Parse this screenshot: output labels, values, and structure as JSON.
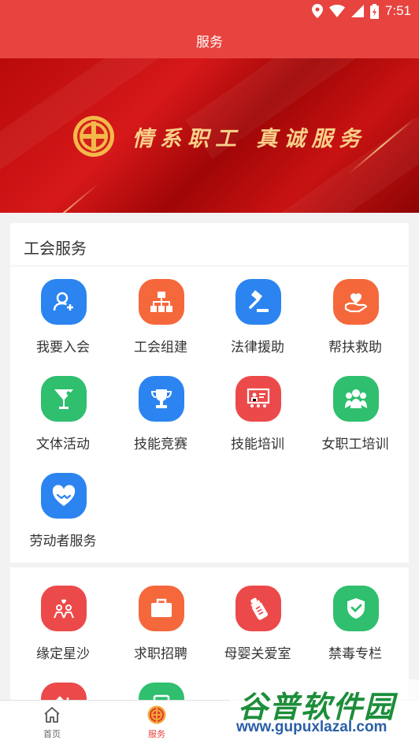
{
  "status_bar": {
    "time": "7:51",
    "icons": [
      "location-icon",
      "wifi-icon",
      "cell-signal-icon",
      "battery-charging-icon"
    ]
  },
  "app_bar": {
    "title": "服务"
  },
  "banner": {
    "slogan": "情系职工 真诚服务",
    "logo": "trade-union-emblem"
  },
  "union_services": {
    "title": "工会服务",
    "items": [
      {
        "label": "我要入会",
        "icon": "add-member-icon",
        "color": "#2b84f0"
      },
      {
        "label": "工会组建",
        "icon": "org-chart-icon",
        "color": "#f5683c"
      },
      {
        "label": "法律援助",
        "icon": "gavel-icon",
        "color": "#2b84f0"
      },
      {
        "label": "帮扶救助",
        "icon": "heart-hand-icon",
        "color": "#f5683c"
      },
      {
        "label": "文体活动",
        "icon": "trophy-cup-icon",
        "color": "#2fbf6e"
      },
      {
        "label": "技能竞赛",
        "icon": "trophy-icon",
        "color": "#2b84f0"
      },
      {
        "label": "技能培训",
        "icon": "training-board-icon",
        "color": "#ec4a4a"
      },
      {
        "label": "女职工培训",
        "icon": "women-group-icon",
        "color": "#2fbf6e"
      },
      {
        "label": "劳动者服务",
        "icon": "handshake-heart-icon",
        "color": "#2b84f0"
      }
    ]
  },
  "more_services": {
    "items": [
      {
        "label": "缘定星沙",
        "icon": "couple-icon",
        "color": "#ec4a4a"
      },
      {
        "label": "求职招聘",
        "icon": "briefcase-icon",
        "color": "#f5683c"
      },
      {
        "label": "母婴关爱室",
        "icon": "baby-bottle-icon",
        "color": "#ec4a4a"
      },
      {
        "label": "禁毒专栏",
        "icon": "shield-check-icon",
        "color": "#2fbf6e"
      },
      {
        "label": "",
        "icon": "sort-icon",
        "color": "#ec4a4a"
      },
      {
        "label": "",
        "icon": "document-icon",
        "color": "#2fbf6e"
      }
    ]
  },
  "bottom_nav": [
    {
      "label": "首页",
      "icon": "home-icon",
      "active": false
    },
    {
      "label": "服务",
      "icon": "union-emblem-icon",
      "active": true
    }
  ],
  "watermark": {
    "name": "谷普软件园",
    "url": "www.gupuxlazal.com"
  }
}
